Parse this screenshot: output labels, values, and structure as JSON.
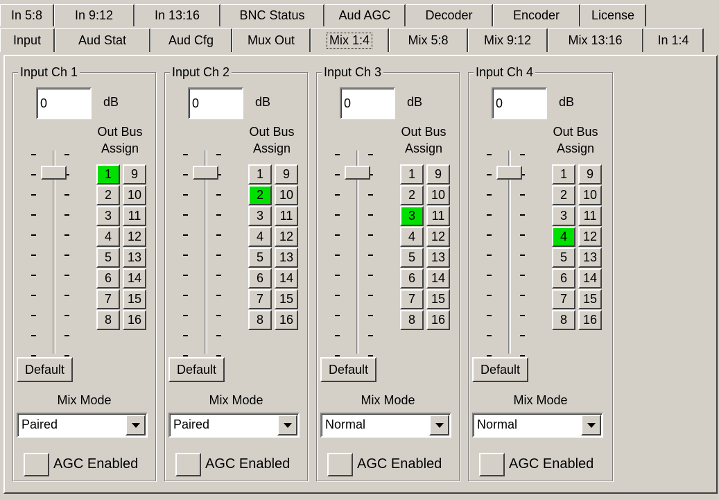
{
  "tabs_back": [
    "In 5:8",
    "In 9:12",
    "In 13:16",
    "BNC Status",
    "Aud AGC",
    "Decoder",
    "Encoder",
    "License"
  ],
  "tabs_front": [
    "Input",
    "Aud Stat",
    "Aud Cfg",
    "Mux Out",
    "Mix 1:4",
    "Mix 5:8",
    "Mix 9:12",
    "Mix 13:16",
    "In 1:4"
  ],
  "active_tab": "Mix 1:4",
  "active_color": "#00e000",
  "common": {
    "db_unit": "dB",
    "bus_line1": "Out Bus",
    "bus_line2": "Assign",
    "bus_buttons": [
      "1",
      "9",
      "2",
      "10",
      "3",
      "11",
      "4",
      "12",
      "5",
      "13",
      "6",
      "14",
      "7",
      "15",
      "8",
      "16"
    ],
    "default_label": "Default",
    "mix_mode_label": "Mix Mode",
    "agc_label": "AGC Enabled"
  },
  "channels": [
    {
      "title": "Input Ch 1",
      "gain": "0",
      "active_bus": "1",
      "mix_mode": "Paired",
      "agc_enabled": false,
      "fader_level": 0.92
    },
    {
      "title": "Input Ch 2",
      "gain": "0",
      "active_bus": "2",
      "mix_mode": "Paired",
      "agc_enabled": false,
      "fader_level": 0.92
    },
    {
      "title": "Input Ch 3",
      "gain": "0",
      "active_bus": "3",
      "mix_mode": "Normal",
      "agc_enabled": false,
      "fader_level": 0.92
    },
    {
      "title": "Input Ch 4",
      "gain": "0",
      "active_bus": "4",
      "mix_mode": "Normal",
      "agc_enabled": false,
      "fader_level": 0.92
    }
  ]
}
